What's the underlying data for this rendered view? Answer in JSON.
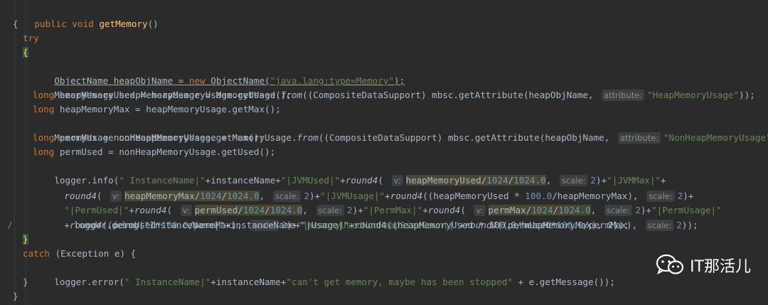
{
  "code": {
    "l1": [
      "public void ",
      "getMemory",
      "()"
    ],
    "l2": "{",
    "l3": "try",
    "l4": "{",
    "l5": [
      "ObjectName heapObjName = ",
      "new ",
      "ObjectName(",
      "\"java.lang:type=Memory\"",
      ");"
    ],
    "l6": [
      "MemoryUsage heapMemoryUsage = MemoryUsage.",
      "from",
      "((CompositeDataSupport) mbsc.getAttribute(heapObjName, ",
      "attribute:",
      "\"HeapMemoryUsage\"",
      "));"
    ],
    "l7": [
      "long ",
      "heapMemoryUsed = heapMemoryUsage.getUsed();"
    ],
    "l8": [
      "long ",
      "heapMemoryMax = heapMemoryUsage.getMax();"
    ],
    "l9": [
      "MemoryUsage nonHeapMemoryUsage = MemoryUsage.",
      "from",
      "((CompositeDataSupport) mbsc.getAttribute(heapObjName, ",
      "attribute:",
      "\"NonHeapMemoryUsage\"",
      "));"
    ],
    "l10": [
      "long ",
      "permMax = nonHeapMemoryUsage.getMax();"
    ],
    "l11": [
      "long ",
      "permUsed = nonHeapMemoryUsage.getUsed();"
    ],
    "l12": [
      "logger.info(",
      "\" InstanceName|\"",
      "+instanceName+",
      "\"|JVMUsed|\"",
      "+",
      "round4",
      "( ",
      "v:",
      "heapMemoryUsed/",
      "1024",
      "/",
      "1024.0",
      ", ",
      "scale:",
      "2",
      ")+",
      "\"|JVMMax|\"",
      "+"
    ],
    "l13": [
      "round4",
      "( ",
      "v:",
      "heapMemoryMax/",
      "1024",
      "/",
      "1024.0",
      ", ",
      "scale:",
      "2",
      ")+",
      "\"|JVMUsage|\"",
      "+",
      "round4",
      "((heapMemoryUsed * ",
      "100.0",
      "/heapMemoryMax), ",
      "scale:",
      "2",
      ")+"
    ],
    "l14": [
      "\"|PermUsed|\"",
      "+",
      "round4",
      "( ",
      "v:",
      "permUsed/",
      "1024",
      "/",
      "1024.0",
      ", ",
      "scale:",
      "2",
      ")+",
      "\"|PermMax|\"",
      "+",
      "round4",
      "( ",
      "v:",
      "permMax/",
      "1024",
      "/",
      "1024.0",
      ", ",
      "scale:",
      "2",
      ")+",
      "\"|PermUsage|\""
    ],
    "l15": [
      "+",
      "round4",
      "((permUsed*",
      "100.0",
      "/permMax), ",
      "scale:",
      "2",
      ")+",
      "\"|memoryUsedNonHeapSizeCount|\"",
      "+",
      "round4",
      "((permUsed*",
      "100.0",
      "/permMax), ",
      "scale:",
      "2",
      "));"
    ],
    "l16": "logger.debug(\"InstanceName|\"+instanceName+\"|Usage|\"+round4((heapMemoryUsed * 100.0/heapMemoryMax), 2));",
    "l16_mark": "/",
    "l17": "}",
    "l18": [
      "catch ",
      "(Exception e) {"
    ],
    "l19": [
      "logger.error(",
      "\" InstanceName|\"",
      "+instanceName+",
      "\"can't get memory, maybe has been stopped\"",
      " + e.getMessage());"
    ],
    "l20": "}",
    "l21": "}"
  },
  "watermark": {
    "text": "IT那活儿",
    "icon": "wechat-icon"
  },
  "colors": {
    "background": "#2b2b2b",
    "keyword": "#cc7832",
    "method": "#ffc66d",
    "string": "#6a8759",
    "number": "#6897bb",
    "text": "#a9b7c6"
  }
}
